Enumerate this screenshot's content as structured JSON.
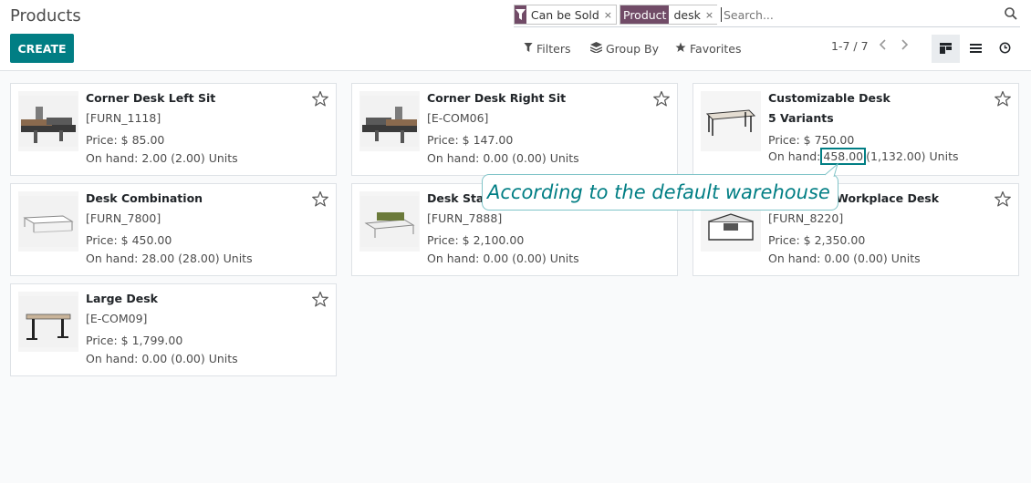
{
  "header": {
    "title": "Products",
    "create_label": "CREATE"
  },
  "search": {
    "facet_filter_value": "Can be Sold",
    "facet_field_label": "Product",
    "facet_field_value": "desk",
    "remove_symbol": "×",
    "placeholder": "Search..."
  },
  "toolbar": {
    "filters_label": "Filters",
    "groupby_label": "Group By",
    "favorites_label": "Favorites",
    "pager_text": "1-7 / 7"
  },
  "products": [
    {
      "name": "Corner Desk Left Sit",
      "ref": "[FURN_1118]",
      "price": "Price: $ 85.00",
      "onhand": "On hand: 2.00 (2.00) Units"
    },
    {
      "name": "Corner Desk Right Sit",
      "ref": "[E-COM06]",
      "price": "Price: $ 147.00",
      "onhand": "On hand: 0.00 (0.00) Units"
    },
    {
      "name": "Customizable Desk",
      "ref": "5 Variants",
      "price": "Price: $ 750.00",
      "onhand_prefix": "On hand:",
      "onhand_value": "458.00",
      "onhand_suffix": "(1,132.00) Units"
    },
    {
      "name": "Desk Combination",
      "ref": "[FURN_7800]",
      "price": "Price: $ 450.00",
      "onhand": "On hand: 28.00 (28.00) Units"
    },
    {
      "name": "Desk Stand with Screen",
      "ref": "[FURN_7888]",
      "price": "Price: $ 2,100.00",
      "onhand": "On hand: 0.00 (0.00) Units"
    },
    {
      "name": "Individual Workplace Desk",
      "ref": "[FURN_8220]",
      "price": "Price: $ 2,350.00",
      "onhand": "On hand: 0.00 (0.00) Units"
    },
    {
      "name": "Large Desk",
      "ref": "[E-COM09]",
      "price": "Price: $ 1,799.00",
      "onhand": "On hand: 0.00 (0.00) Units"
    }
  ],
  "tooltip": {
    "text": "According to the default warehouse"
  },
  "colors": {
    "primary": "#017e84",
    "facet": "#714b67"
  }
}
